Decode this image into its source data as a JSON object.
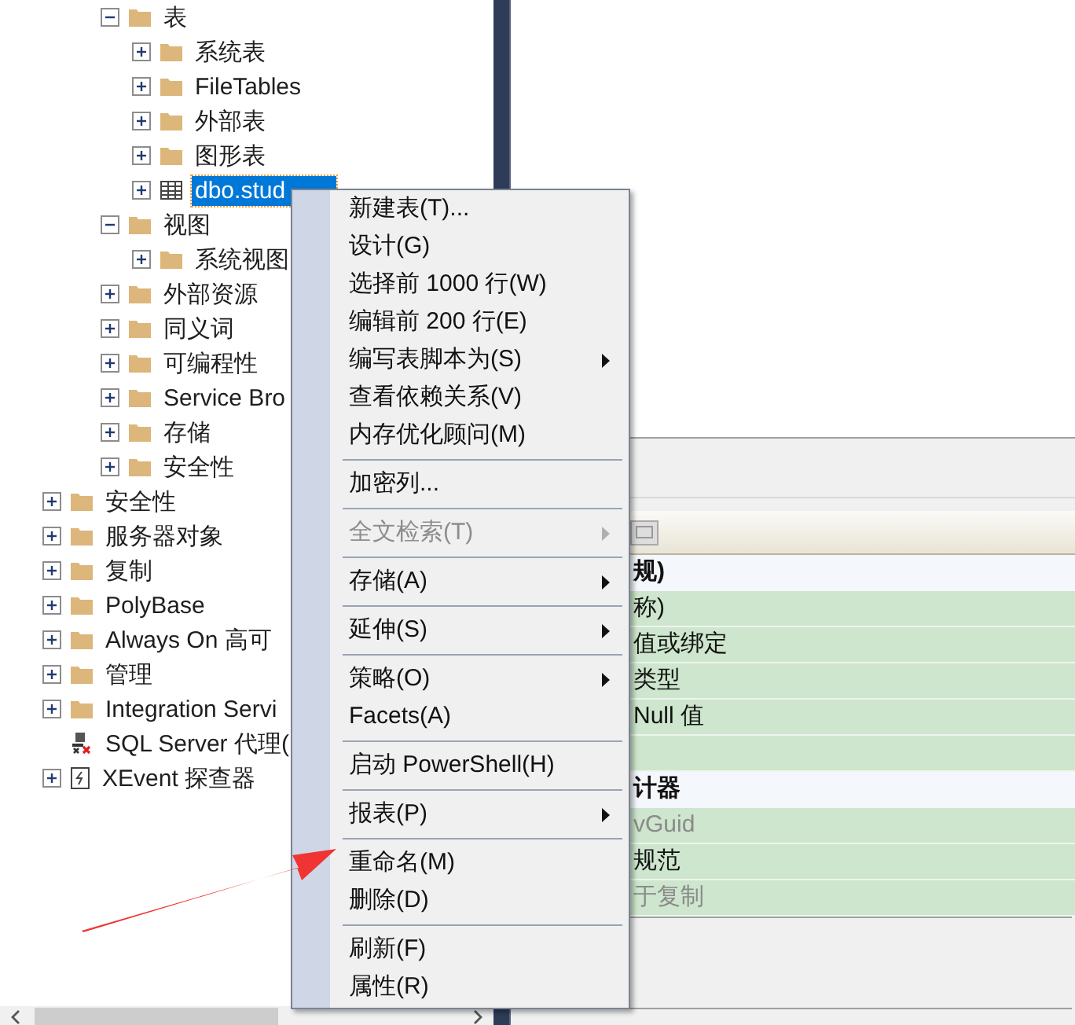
{
  "tree": {
    "open_branch": [
      {
        "label": "表",
        "kind": "folder",
        "expanded": true,
        "selected": false,
        "children": [
          {
            "label": "系统表",
            "kind": "folder",
            "expanded": false,
            "selected": false
          },
          {
            "label": "FileTables",
            "kind": "folder",
            "expanded": false,
            "selected": false
          },
          {
            "label": "外部表",
            "kind": "folder",
            "expanded": false,
            "selected": false
          },
          {
            "label": "图形表",
            "kind": "folder",
            "expanded": false,
            "selected": false
          },
          {
            "label": "dbo.stud",
            "kind": "table",
            "expanded": false,
            "selected": true
          }
        ]
      },
      {
        "label": "视图",
        "kind": "folder",
        "expanded": true,
        "selected": false,
        "children": [
          {
            "label": "系统视图",
            "kind": "folder",
            "expanded": false,
            "selected": false
          }
        ]
      },
      {
        "label": "外部资源",
        "kind": "folder",
        "expanded": false,
        "selected": false
      },
      {
        "label": "同义词",
        "kind": "folder",
        "expanded": false,
        "selected": false
      },
      {
        "label": "可编程性",
        "kind": "folder",
        "expanded": false,
        "selected": false
      },
      {
        "label": "Service Bro",
        "kind": "folder",
        "expanded": false,
        "selected": false
      },
      {
        "label": "存储",
        "kind": "folder",
        "expanded": false,
        "selected": false
      },
      {
        "label": "安全性",
        "kind": "folder",
        "expanded": false,
        "selected": false
      }
    ],
    "nodes": [
      {
        "label": "安全性",
        "kind": "folder",
        "expanded": false,
        "selected": false
      },
      {
        "label": "服务器对象",
        "kind": "folder",
        "expanded": false,
        "selected": false
      },
      {
        "label": "复制",
        "kind": "folder",
        "expanded": false,
        "selected": false
      },
      {
        "label": "PolyBase",
        "kind": "folder",
        "expanded": false,
        "selected": false
      },
      {
        "label": "Always On 高可",
        "kind": "folder",
        "expanded": false,
        "selected": false
      },
      {
        "label": "管理",
        "kind": "folder",
        "expanded": false,
        "selected": false
      },
      {
        "label": "Integration Servi",
        "kind": "folder",
        "expanded": false,
        "selected": false
      },
      {
        "label": "SQL Server 代理(",
        "kind": "agent",
        "selected": false
      },
      {
        "label": "XEvent 探查器",
        "kind": "xevent",
        "expanded": false,
        "selected": false
      }
    ]
  },
  "properties": [
    {
      "kind": "category",
      "text": "规)"
    },
    {
      "kind": "property",
      "text": "称)",
      "dimmed": false
    },
    {
      "kind": "property",
      "text": "值或绑定",
      "dimmed": false
    },
    {
      "kind": "property",
      "text": "类型",
      "dimmed": false
    },
    {
      "kind": "property",
      "text": "Null 值",
      "dimmed": false
    },
    {
      "kind": "property",
      "dimmed": false
    },
    {
      "kind": "category",
      "text": "计器"
    },
    {
      "kind": "property",
      "text": "vGuid",
      "dimmed": true
    },
    {
      "kind": "property",
      "text": "规范",
      "dimmed": false
    },
    {
      "kind": "property",
      "text": "于复制",
      "dimmed": true
    }
  ],
  "context_menu": [
    {
      "kind": "item",
      "label": "新建表(T)...",
      "submenu": false,
      "disabled": false
    },
    {
      "kind": "item",
      "label": "设计(G)",
      "submenu": false,
      "disabled": false
    },
    {
      "kind": "item",
      "label": "选择前 1000 行(W)",
      "submenu": false,
      "disabled": false
    },
    {
      "kind": "item",
      "label": "编辑前 200 行(E)",
      "submenu": false,
      "disabled": false
    },
    {
      "kind": "item",
      "label": "编写表脚本为(S)",
      "submenu": true,
      "disabled": false
    },
    {
      "kind": "item",
      "label": "查看依赖关系(V)",
      "submenu": false,
      "disabled": false
    },
    {
      "kind": "item",
      "label": "内存优化顾问(M)",
      "submenu": false,
      "disabled": false
    },
    {
      "kind": "separator"
    },
    {
      "kind": "item",
      "label": "加密列...",
      "submenu": false,
      "disabled": false
    },
    {
      "kind": "separator"
    },
    {
      "kind": "item",
      "label": "全文检索(T)",
      "submenu": true,
      "disabled": true
    },
    {
      "kind": "separator"
    },
    {
      "kind": "item",
      "label": "存储(A)",
      "submenu": true,
      "disabled": false
    },
    {
      "kind": "separator"
    },
    {
      "kind": "item",
      "label": "延伸(S)",
      "submenu": true,
      "disabled": false
    },
    {
      "kind": "separator"
    },
    {
      "kind": "item",
      "label": "策略(O)",
      "submenu": true,
      "disabled": false
    },
    {
      "kind": "item",
      "label": "Facets(A)",
      "submenu": false,
      "disabled": false
    },
    {
      "kind": "separator"
    },
    {
      "kind": "item",
      "label": "启动 PowerShell(H)",
      "submenu": false,
      "disabled": false
    },
    {
      "kind": "separator"
    },
    {
      "kind": "item",
      "label": "报表(P)",
      "submenu": true,
      "disabled": false
    },
    {
      "kind": "separator"
    },
    {
      "kind": "item",
      "label": "重命名(M)",
      "submenu": false,
      "disabled": false
    },
    {
      "kind": "item",
      "label": "删除(D)",
      "submenu": false,
      "disabled": false
    },
    {
      "kind": "separator"
    },
    {
      "kind": "item",
      "label": "刷新(F)",
      "submenu": false,
      "disabled": false
    },
    {
      "kind": "item",
      "label": "属性(R)",
      "submenu": false,
      "disabled": false
    }
  ]
}
